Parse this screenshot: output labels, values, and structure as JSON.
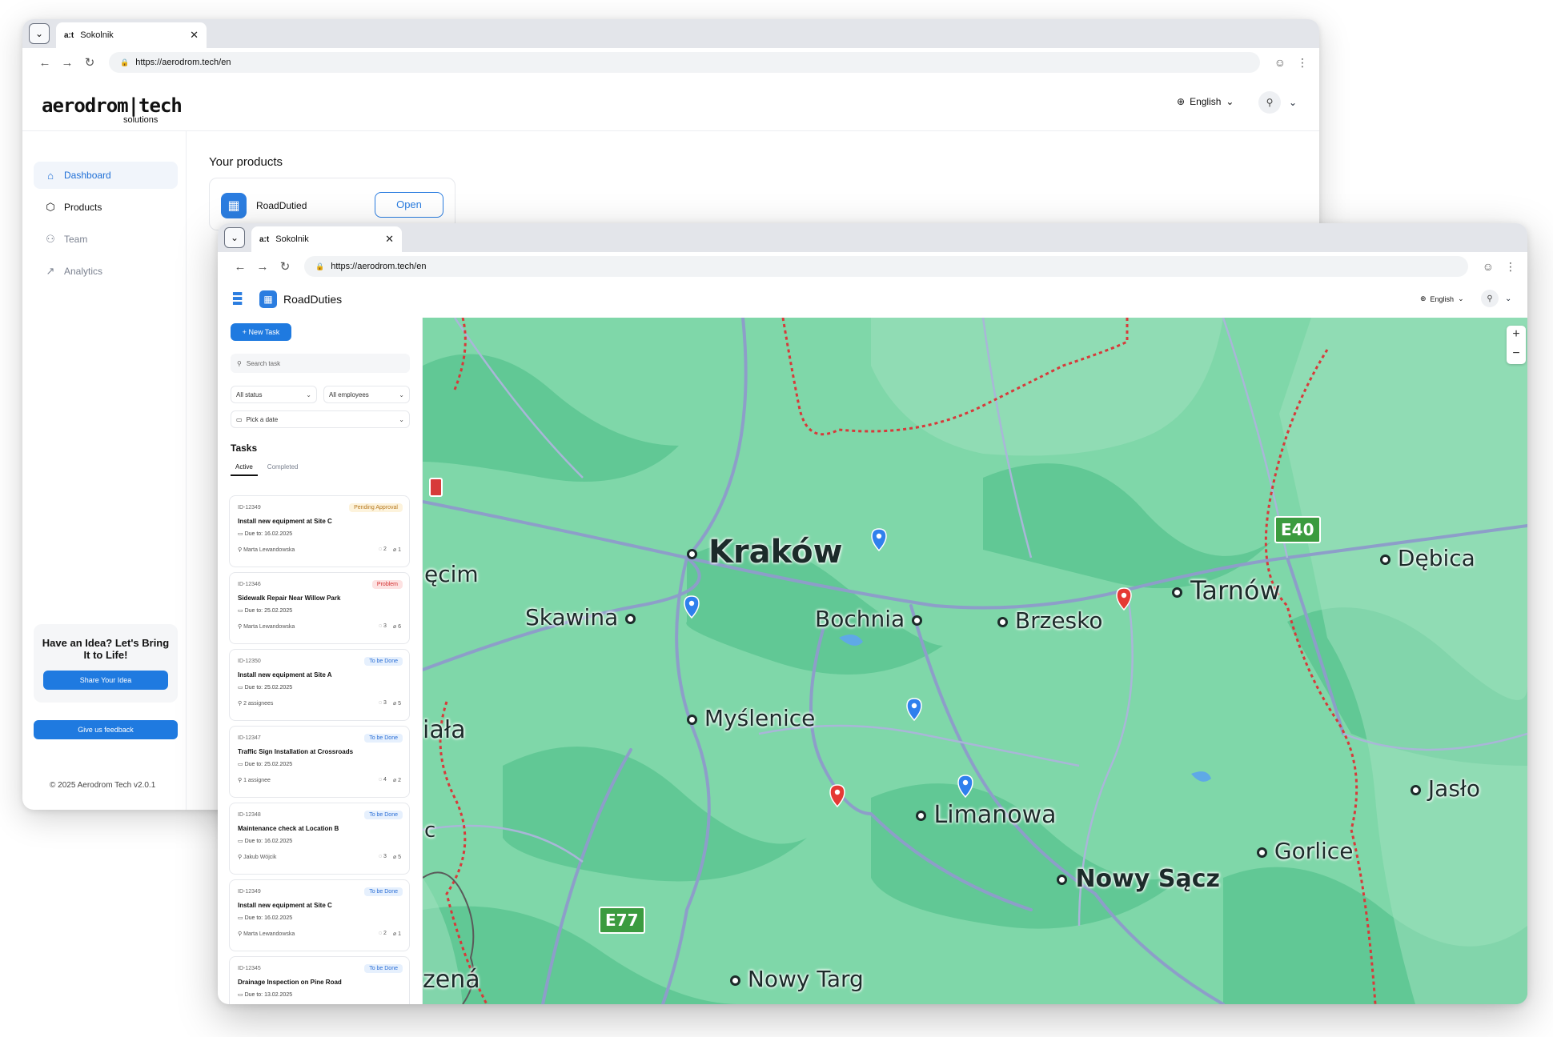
{
  "back_window": {
    "tab_favicon": "a:t",
    "tab_title": "Sokolnik",
    "url": "https://aerodrom.tech/en",
    "logo_main": "aerodrom|tech",
    "logo_sub": "solutions",
    "language": "English",
    "sidebar": [
      {
        "label": "Dashboard",
        "icon": "home-icon"
      },
      {
        "label": "Products",
        "icon": "box-icon"
      },
      {
        "label": "Team",
        "icon": "users-icon"
      },
      {
        "label": "Analytics",
        "icon": "chart-icon"
      }
    ],
    "idea_title": "Have an Idea? Let's Bring It to Life!",
    "idea_button": "Share Your Idea",
    "feedback_button": "Give us feedback",
    "footer": "© 2025 Aerodrom Tech v2.0.1",
    "products_title": "Your products",
    "product_name": "RoadDutied",
    "open_button": "Open"
  },
  "front_window": {
    "tab_favicon": "a:t",
    "tab_title": "Sokolnik",
    "url": "https://aerodrom.tech/en",
    "app_name": "RoadDuties",
    "language": "English",
    "new_task": "New Task",
    "search_placeholder": "Search task",
    "status_filter": "All status",
    "employee_filter": "All employees",
    "date_filter": "Pick a date",
    "tasks_title": "Tasks",
    "tab_active": "Active",
    "tab_completed": "Completed",
    "tasks": [
      {
        "id": "ID-12349",
        "status": "Pending Approval",
        "title": "Install new equipment at Site C",
        "due": "Due to: 16.02.2025",
        "assignee": "Marta Lewandowska",
        "comments": "2",
        "attachments": "1"
      },
      {
        "id": "ID-12346",
        "status": "Problem",
        "title": "Sidewalk Repair Near Willow Park",
        "due": "Due to: 25.02.2025",
        "assignee": "Marta Lewandowska",
        "comments": "3",
        "attachments": "6"
      },
      {
        "id": "ID-12350",
        "status": "To be Done",
        "title": "Install new equipment at Site A",
        "due": "Due to: 25.02.2025",
        "assignee": "2 assignees",
        "comments": "3",
        "attachments": "5"
      },
      {
        "id": "ID-12347",
        "status": "To be Done",
        "title": "Traffic Sign Installation at Crossroads",
        "due": "Due to: 25.02.2025",
        "assignee": "1 assignee",
        "comments": "4",
        "attachments": "2"
      },
      {
        "id": "ID-12348",
        "status": "To be Done",
        "title": "Maintenance check at Location B",
        "due": "Due to: 16.02.2025",
        "assignee": "Jakub Wójcik",
        "comments": "3",
        "attachments": "5"
      },
      {
        "id": "ID-12349",
        "status": "To be Done",
        "title": "Install new equipment at Site C",
        "due": "Due to: 16.02.2025",
        "assignee": "Marta Lewandowska",
        "comments": "2",
        "attachments": "1"
      },
      {
        "id": "ID-12345",
        "status": "To be Done",
        "title": "Drainage Inspection on Pine Road",
        "due": "Due to: 13.02.2025",
        "assignee": "",
        "comments": "",
        "attachments": ""
      }
    ],
    "map": {
      "cities": {
        "krakow": "Kraków",
        "skawina": "Skawina",
        "bochnia": "Bochnia",
        "brzesko": "Brzesko",
        "tarnow": "Tarnów",
        "debica": "Dębica",
        "myslenice": "Myślenice",
        "limanowa": "Limanowa",
        "nowy_sacz": "Nowy Sącz",
        "gorlice": "Gorlice",
        "jaslo": "Jasło",
        "nowy_targ": "Nowy Targ",
        "oswiecim_partial": "ęcim",
        "biala_partial": "iała",
        "zielona_partial": "zená",
        "edge_c": "c"
      },
      "roads": {
        "e40": "E40",
        "e77": "E77"
      },
      "zoom_in": "+",
      "zoom_out": "−"
    }
  }
}
